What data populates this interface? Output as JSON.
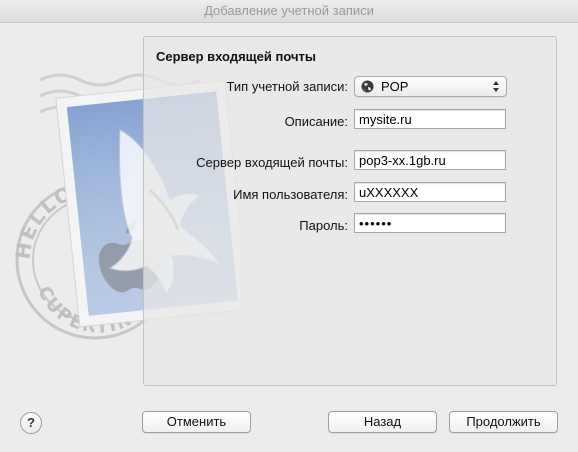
{
  "window": {
    "title": "Добавление учетной записи"
  },
  "panel": {
    "title": "Сервер входящей почты"
  },
  "form": {
    "account_type_label": "Тип учетной записи:",
    "account_type_value": "POP",
    "description_label": "Описание:",
    "description_value": "mysite.ru",
    "server_label": "Сервер входящей почты:",
    "server_value": "pop3-xx.1gb.ru",
    "username_label": "Имя пользователя:",
    "username_value": "uXXXXXX",
    "password_label": "Пароль:",
    "password_value": "••••••"
  },
  "stamp": {
    "text_top": "HELLO FR",
    "text_bottom": "CUPERTINO, CA"
  },
  "buttons": {
    "help": "?",
    "cancel": "Отменить",
    "back": "Назад",
    "continue": "Продолжить"
  },
  "icons": {
    "account_type": "globe-icon",
    "popup": "up-down-arrows-icon",
    "help": "help-icon"
  }
}
